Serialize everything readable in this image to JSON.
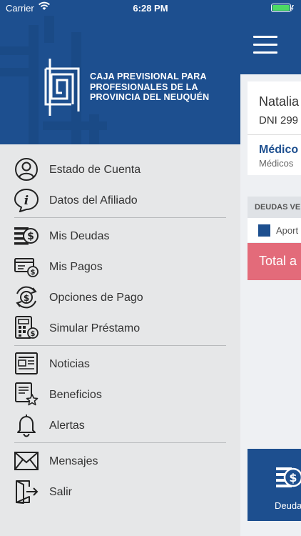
{
  "status_bar": {
    "carrier": "Carrier",
    "time": "6:28 PM"
  },
  "org": {
    "line1": "CAJA PREVISIONAL PARA",
    "line2": "PROFESIONALES DE LA",
    "line3": "PROVINCIA DEL NEUQUÉN"
  },
  "menu": {
    "estado_cuenta": "Estado de Cuenta",
    "datos_afiliado": "Datos del Afiliado",
    "mis_deudas": "Mis Deudas",
    "mis_pagos": "Mis Pagos",
    "opciones_pago": "Opciones de Pago",
    "simular_prestamo": "Simular Préstamo",
    "noticias": "Noticias",
    "beneficios": "Beneficios",
    "alertas": "Alertas",
    "mensajes": "Mensajes",
    "salir": "Salir"
  },
  "background_app": {
    "name": "Natalia",
    "dni": "DNI 299",
    "category": "Médico",
    "category_sub": "Médicos",
    "section_title": "DEUDAS VE",
    "legend_item": "Aport",
    "total_label": "Total a",
    "bottom_button": "Deuda"
  },
  "colors": {
    "brand_blue": "#1d4f8f",
    "drawer_bg": "#e6e7e8",
    "total_red": "#e36b7a"
  },
  "icons": {
    "estado_cuenta": "user-circle-icon",
    "datos_afiliado": "info-icon",
    "mis_deudas": "money-stack-icon",
    "mis_pagos": "bill-icon",
    "opciones_pago": "coin-refresh-icon",
    "simular_prestamo": "calculator-icon",
    "noticias": "newspaper-icon",
    "beneficios": "document-star-icon",
    "alertas": "bell-icon",
    "mensajes": "envelope-icon",
    "salir": "logout-door-icon"
  }
}
